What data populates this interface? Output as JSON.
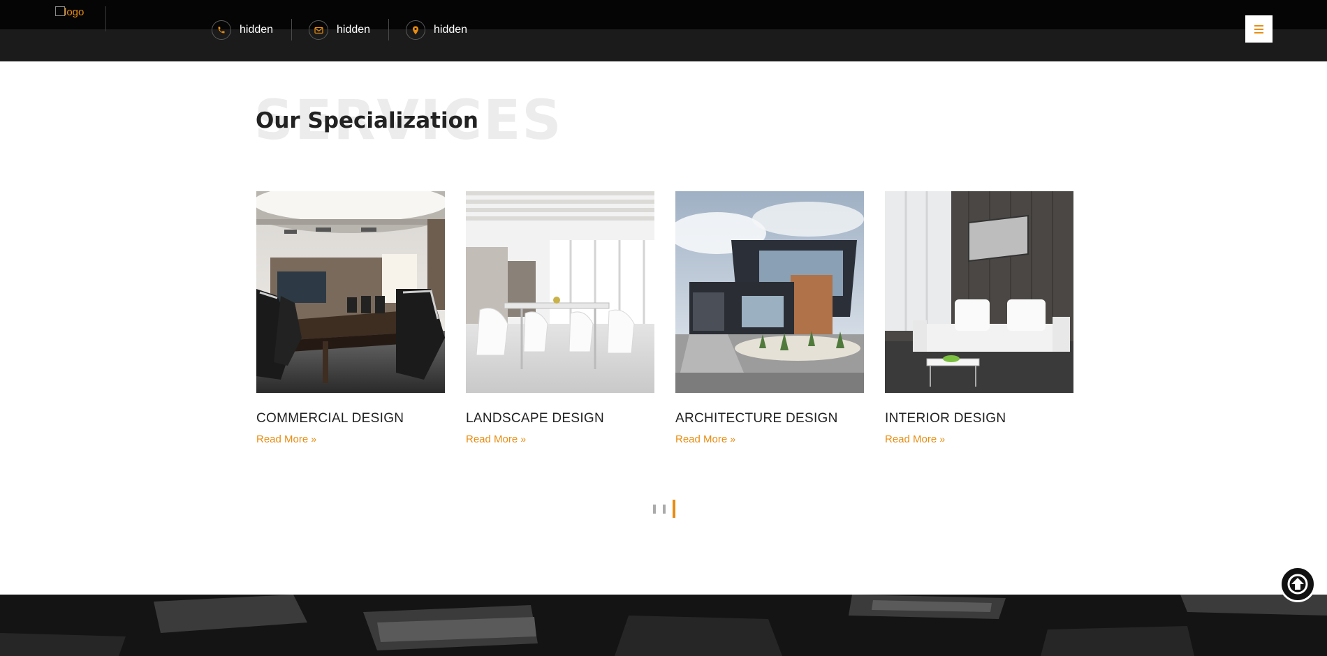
{
  "header": {
    "logo_alt": "logo",
    "contacts": [
      {
        "icon": "phone-icon",
        "label": "hidden"
      },
      {
        "icon": "envelope-icon",
        "label": "hidden"
      },
      {
        "icon": "map-marker-icon",
        "label": "hidden"
      }
    ],
    "menu_icon": "hamburger-menu-icon"
  },
  "section": {
    "background_word": "SERVICES",
    "title": "Our Specialization"
  },
  "services": [
    {
      "name": "COMMERCIAL DESIGN",
      "link": "Read More",
      "link_icon": "double-chevron-right-icon"
    },
    {
      "name": "LANDSCAPE DESIGN",
      "link": "Read More",
      "link_icon": "double-chevron-right-icon"
    },
    {
      "name": "ARCHITECTURE DESIGN",
      "link": "Read More",
      "link_icon": "double-chevron-right-icon"
    },
    {
      "name": "INTERIOR DESIGN",
      "link": "Read More",
      "link_icon": "double-chevron-right-icon"
    }
  ],
  "pager": {
    "pages": 3,
    "active_index": 2
  },
  "back_to_top_icon": "arrow-up-circle-icon",
  "colors": {
    "accent": "#e88d11",
    "header_bg": "#050505",
    "header_lower_bg": "#1b1b1b",
    "footer_bg": "#141414",
    "title_text": "#222222",
    "background_word": "#ececec"
  }
}
